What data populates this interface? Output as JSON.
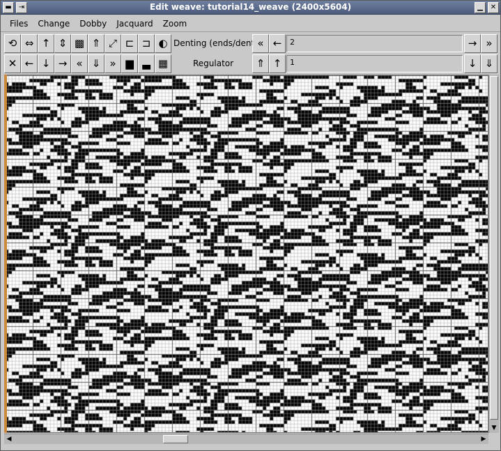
{
  "window": {
    "title": "Edit weave: tutorial14_weave (2400x5604)",
    "menu_icon": "window-menu-icon",
    "minimize_icon": "minimize-icon",
    "close_icon": "close-icon"
  },
  "menu": {
    "items": [
      "Files",
      "Change",
      "Dobby",
      "Jacquard",
      "Zoom"
    ]
  },
  "toolbar": {
    "row1_buttons": [
      {
        "name": "rotate-icon",
        "glyph": "⟲"
      },
      {
        "name": "flip-horizontal-icon",
        "glyph": "⇔"
      },
      {
        "name": "arrow-up-icon",
        "glyph": "↑"
      },
      {
        "name": "flip-vertical-icon",
        "glyph": "⇕"
      },
      {
        "name": "invert-pattern-icon",
        "glyph": "▩"
      },
      {
        "name": "double-up-icon",
        "glyph": "⇑"
      },
      {
        "name": "diagonal-icon",
        "glyph": "⤢"
      },
      {
        "name": "steps-up-icon",
        "glyph": "⊏"
      },
      {
        "name": "steps-down-icon",
        "glyph": "⊐"
      },
      {
        "name": "half-fill-icon",
        "glyph": "◐"
      }
    ],
    "row2_buttons": [
      {
        "name": "close-cross-icon",
        "glyph": "✕"
      },
      {
        "name": "arrow-left-icon",
        "glyph": "←"
      },
      {
        "name": "arrow-down-icon",
        "glyph": "↓"
      },
      {
        "name": "arrow-right-icon",
        "glyph": "→"
      },
      {
        "name": "double-left-icon",
        "glyph": "«"
      },
      {
        "name": "double-down-icon",
        "glyph": "⇓"
      },
      {
        "name": "double-right-icon",
        "glyph": "»"
      },
      {
        "name": "bars-up-icon",
        "glyph": "▆"
      },
      {
        "name": "bars-down-icon",
        "glyph": "▃"
      },
      {
        "name": "checker-icon",
        "glyph": "▦"
      }
    ],
    "denting_label": "Denting (ends/dent)",
    "denting_value": "2",
    "regulator_label": "Regulator",
    "regulator_value": "1",
    "nav": {
      "fast_left": "«",
      "left": "←",
      "right": "→",
      "fast_right": "»",
      "fast_up": "⇑",
      "up": "↑",
      "down": "↓",
      "fast_down": "⇓"
    }
  },
  "weave": {
    "cell_size": 5,
    "filled_color": "#000000",
    "empty_color": "#ffffff",
    "grid_color": "#a0a0a0",
    "edge_color": "#c98a3a"
  },
  "scrollbars": {
    "up_arrow": "▲",
    "down_arrow": "▼",
    "left_arrow": "◀",
    "right_arrow": "▶"
  }
}
